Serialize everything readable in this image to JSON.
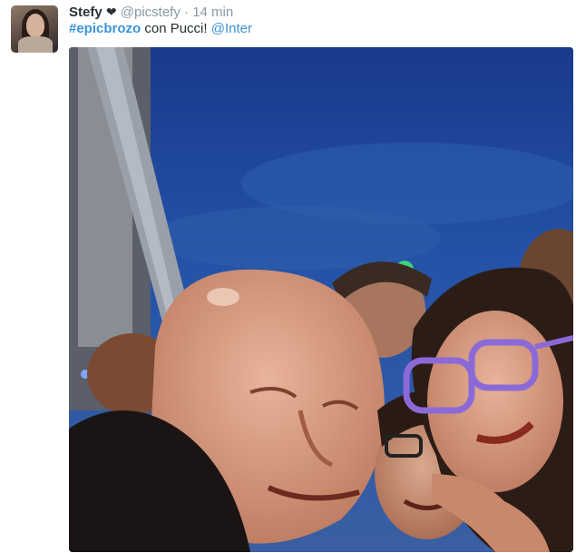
{
  "tweet": {
    "author_name": "Stefy",
    "heart": "❤",
    "handle": "@picstefy",
    "separator": "·",
    "time": "14 min",
    "text": {
      "hashtag": "#epicbrozo",
      "middle": " con Pucci! ",
      "mention": "@Inter"
    }
  },
  "colors": {
    "link": "#3b94d9",
    "text": "#292f33",
    "muted": "#8899a6"
  }
}
